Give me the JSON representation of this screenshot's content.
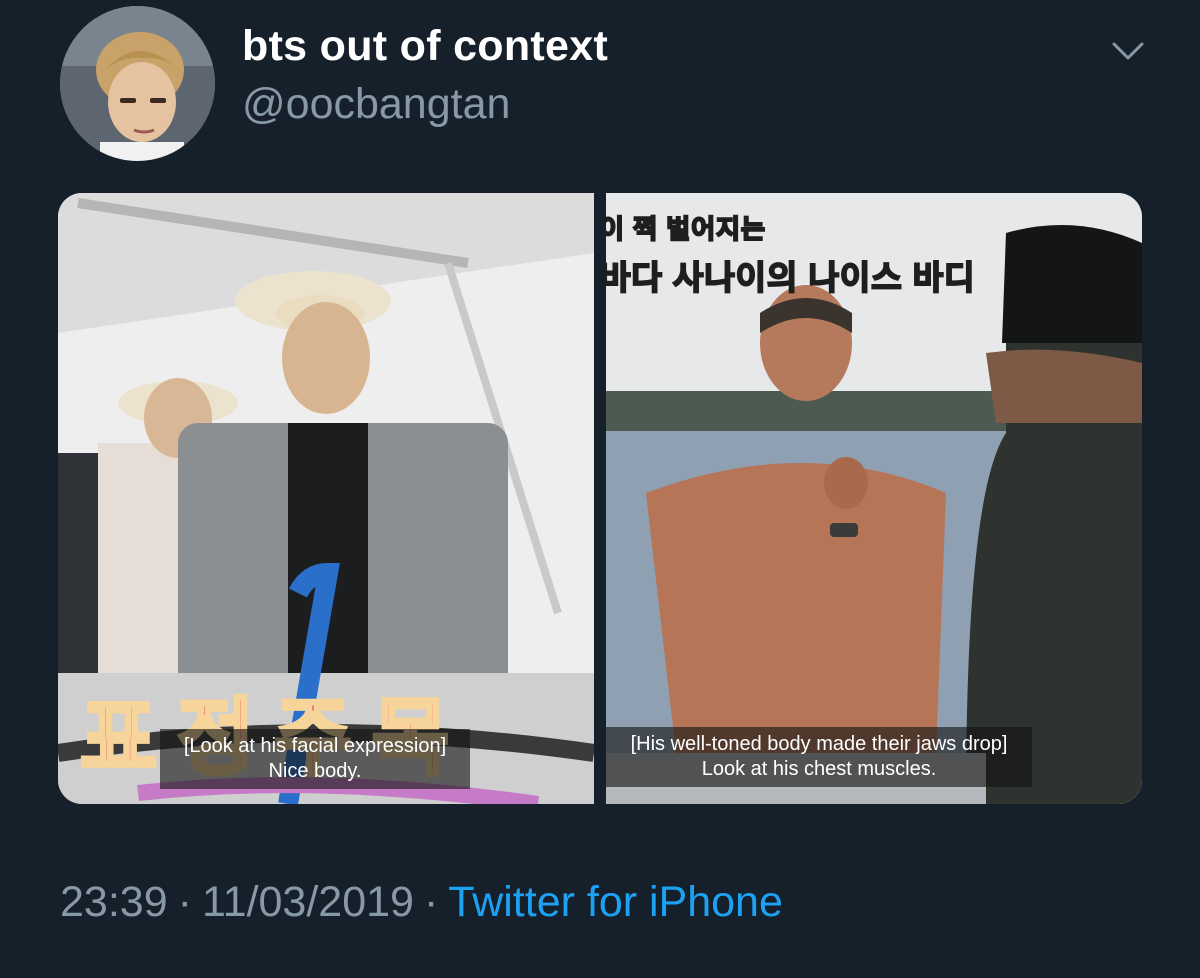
{
  "tweet": {
    "display_name": "bts out of context",
    "handle": "@oocbangtan",
    "avatar": {
      "icon": "profile-photo-icon"
    },
    "menu_icon": "chevron-down-icon"
  },
  "media": {
    "left": {
      "big_caption_ko": "표정주목",
      "subtitle_line1": "[Look at his facial expression]",
      "subtitle_line2": "Nice body."
    },
    "right": {
      "caption_ko_line1": "이 쩍 벌어지는",
      "caption_ko_line2": "바다 사나이의 나이스 바디",
      "subtitle_line1": "[His well-toned body made their jaws drop]",
      "subtitle_line2": "Look at his chest muscles."
    }
  },
  "meta": {
    "time": "23:39",
    "separator": "·",
    "date": "11/03/2019",
    "source": "Twitter for iPhone"
  },
  "colors": {
    "background": "#15202b",
    "text_primary": "#ffffff",
    "text_secondary": "#8899a6",
    "link": "#1da1f2"
  }
}
